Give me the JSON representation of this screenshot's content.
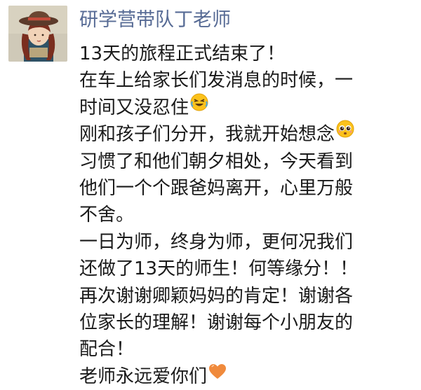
{
  "post": {
    "author": "研学营带队丁老师",
    "lines": [
      "13天的旅程正式结束了！",
      "在车上给家长们发消息的时候，一",
      "时间又没忍住",
      "刚和孩子们分开，我就开始想念",
      "习惯了和他们朝夕相处，今天看到",
      "他们一个个跟爸妈离开，心里万般",
      "不舍。",
      "一日为师，终身为师，更何况我们",
      "还做了13天的师生！何等缘分！！",
      "再次谢谢卿颖妈妈的肯定！谢谢各",
      "位家长的理解！谢谢每个小朋友的",
      "配合！",
      "老师永远爱你们"
    ],
    "emojis": [
      "crying-laughing-emoji",
      "pleading-emoji",
      "orange-heart-emoji"
    ]
  },
  "colors": {
    "author_name": "#576b95",
    "text": "#1a1a1a",
    "heart": "#f08a3c",
    "emoji_yellow": "#fcc21b"
  }
}
